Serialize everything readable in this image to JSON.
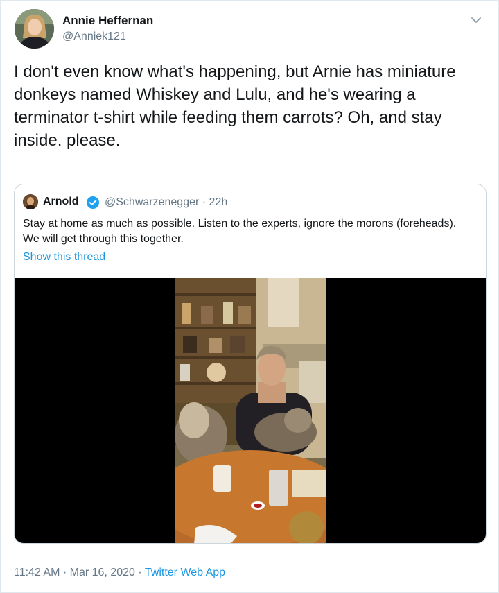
{
  "author": {
    "name": "Annie Heffernan",
    "handle": "@Anniek121"
  },
  "tweet": {
    "text": "I don't even know what's happening, but Arnie has miniature donkeys named Whiskey and Lulu, and he's wearing a terminator t-shirt while feeding them carrots? Oh, and stay inside. please."
  },
  "quote": {
    "name": "Arnold",
    "handle": "@Schwarzenegger",
    "separator": "·",
    "time": "22h",
    "text": "Stay at home as much as possible. Listen to the experts, ignore the morons (foreheads). We will get through this together.",
    "thread_link": "Show this thread"
  },
  "footer": {
    "time": "11:42 AM",
    "separator1": "·",
    "date": "Mar 16, 2020",
    "separator2": "·",
    "app": "Twitter Web App"
  },
  "icons": {
    "menu": "chevron-down-icon",
    "verified": "verified-badge-icon"
  },
  "colors": {
    "link": "#1b95e0",
    "secondary_text": "#657786",
    "verified": "#1da1f2",
    "border": "#ccd6dd"
  }
}
